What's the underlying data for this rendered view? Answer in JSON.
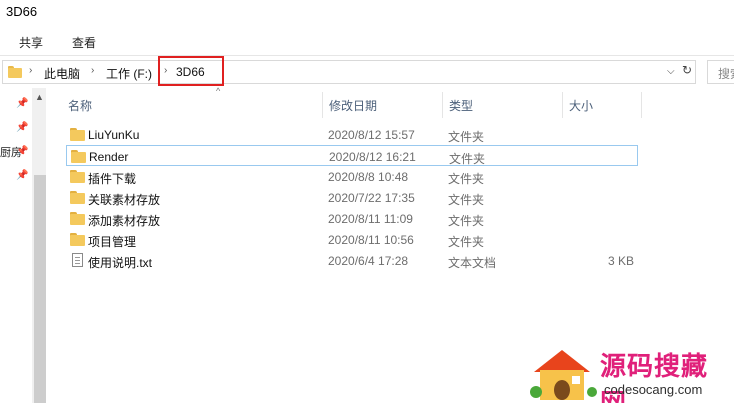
{
  "window": {
    "title": "3D66"
  },
  "ribbon": {
    "tabs": [
      "共享",
      "查看"
    ]
  },
  "address": {
    "crumbs": [
      "此电脑",
      "工作 (F:)",
      "3D66"
    ],
    "search_placeholder": "搜索"
  },
  "nav": {
    "partial_label": "厨房"
  },
  "columns": {
    "name": "名称",
    "date": "修改日期",
    "type": "类型",
    "size": "大小"
  },
  "files": [
    {
      "name": "LiuYunKu",
      "date": "2020/8/12 15:57",
      "type": "文件夹",
      "size": "",
      "icon": "folder-icon"
    },
    {
      "name": "Render",
      "date": "2020/8/12 16:21",
      "type": "文件夹",
      "size": "",
      "icon": "folder-icon"
    },
    {
      "name": "插件下载",
      "date": "2020/8/8 10:48",
      "type": "文件夹",
      "size": "",
      "icon": "folder-icon"
    },
    {
      "name": "关联素材存放",
      "date": "2020/7/22 17:35",
      "type": "文件夹",
      "size": "",
      "icon": "folder-icon"
    },
    {
      "name": "添加素材存放",
      "date": "2020/8/11 11:09",
      "type": "文件夹",
      "size": "",
      "icon": "folder-icon"
    },
    {
      "name": "项目管理",
      "date": "2020/8/11 10:56",
      "type": "文件夹",
      "size": "",
      "icon": "folder-icon"
    },
    {
      "name": "使用说明.txt",
      "date": "2020/6/4 17:28",
      "type": "文本文档",
      "size": "3 KB",
      "icon": "text-file-icon"
    }
  ],
  "selected_row": 1,
  "watermark": {
    "title": "源码搜藏网",
    "url": "codesocang.com"
  },
  "colors": {
    "highlight": "#e02020",
    "folder": "#f4c95d",
    "selection": "#99c9ef",
    "watermark": "#e0207a"
  }
}
